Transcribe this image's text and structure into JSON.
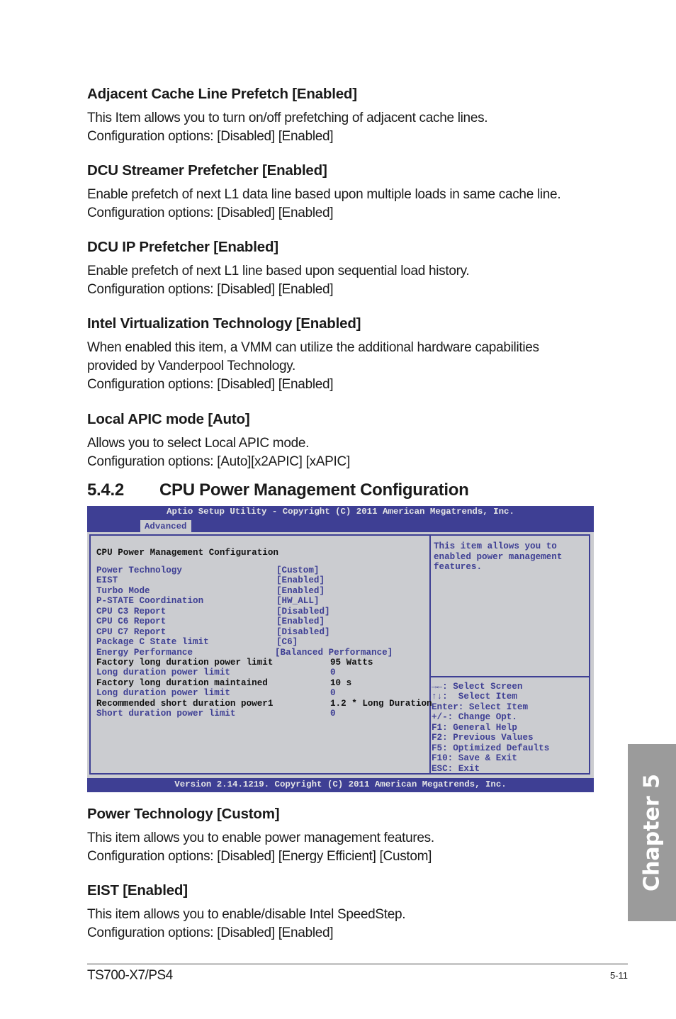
{
  "sections_top": [
    {
      "title": "Adjacent Cache Line Prefetch [Enabled]",
      "lines": [
        "This Item allows you to turn on/off prefetching of adjacent cache lines.",
        "Configuration options: [Disabled] [Enabled]"
      ]
    },
    {
      "title": "DCU Streamer Prefetcher [Enabled]",
      "lines": [
        "Enable prefetch of next L1 data line based upon multiple loads in same cache line.",
        "Configuration options: [Disabled] [Enabled]"
      ]
    },
    {
      "title": "DCU IP Prefetcher [Enabled]",
      "lines": [
        "Enable prefetch of next L1 line based upon sequential load history.",
        "Configuration options: [Disabled] [Enabled]"
      ]
    },
    {
      "title": "Intel Virtualization Technology [Enabled]",
      "lines": [
        "When enabled this item, a VMM can utilize the additional hardware capabilities",
        "provided by Vanderpool Technology.",
        "Configuration options: [Disabled] [Enabled]"
      ]
    },
    {
      "title": "Local APIC mode [Auto]",
      "lines": [
        "Allows you to select Local APIC mode.",
        "Configuration options: [Auto][x2APIC] [xAPIC]"
      ]
    }
  ],
  "subsection": {
    "number": "5.4.2",
    "title": "CPU Power Management Configuration"
  },
  "bios": {
    "title": "Aptio Setup Utility - Copyright (C) 2011 American Megatrends, Inc.",
    "active_tab": "Advanced",
    "heading": "CPU Power Management Configuration",
    "rows": [
      {
        "label": "Power Technology",
        "value": "[Custom]",
        "selectable": true
      },
      {
        "label": "EIST",
        "value": "[Enabled]",
        "selectable": true
      },
      {
        "label": "Turbo Mode",
        "value": "[Enabled]",
        "selectable": true
      },
      {
        "label": "P-STATE Coordination",
        "value": "[HW_ALL]",
        "selectable": true
      },
      {
        "label": "CPU C3 Report",
        "value": "[Disabled]",
        "selectable": true
      },
      {
        "label": "CPU C6 Report",
        "value": "[Enabled]",
        "selectable": true
      },
      {
        "label": "CPU C7 Report",
        "value": "[Disabled]",
        "selectable": true
      },
      {
        "label": "Package C State limit",
        "value": "[C6]",
        "selectable": true
      },
      {
        "label": "Energy Performance",
        "value": "[Balanced Performance]",
        "selectable": true
      },
      {
        "label": "Factory long duration power limit",
        "value": "95 Watts",
        "selectable": false
      },
      {
        "label": "Long duration power limit",
        "value": "0",
        "selectable": true
      },
      {
        "label": "Factory long duration maintained",
        "value": "10 s",
        "selectable": false
      },
      {
        "label": "Long duration power limit",
        "value": "0",
        "selectable": true
      },
      {
        "label": "Recommended short duration power1",
        "value": "1.2 * Long Duration",
        "selectable": false
      },
      {
        "label": "Short duration power limit",
        "value": "0",
        "selectable": true
      }
    ],
    "help_text": "This item allows you to\nenabled power management\nfeatures.",
    "keys": [
      "→←: Select Screen",
      "↑↓:  Select Item",
      "Enter: Select Item",
      "+/-: Change Opt.",
      "F1: General Help",
      "F2: Previous Values",
      "F5: Optimized Defaults",
      "F10: Save & Exit",
      "ESC: Exit"
    ],
    "version": "Version 2.14.1219. Copyright (C) 2011 American Megatrends, Inc."
  },
  "sections_bottom": [
    {
      "title": "Power Technology [Custom]",
      "lines": [
        "This item allows you to enable power management features.",
        "Configuration options: [Disabled] [Energy Efficient] [Custom]"
      ]
    },
    {
      "title": "EIST [Enabled]",
      "lines": [
        "This item allows you to enable/disable Intel SpeedStep.",
        "Configuration options: [Disabled] [Enabled]"
      ]
    }
  ],
  "chapter_tab": "Chapter 5",
  "footer": {
    "model": "TS700-X7/PS4",
    "page": "5-11"
  }
}
